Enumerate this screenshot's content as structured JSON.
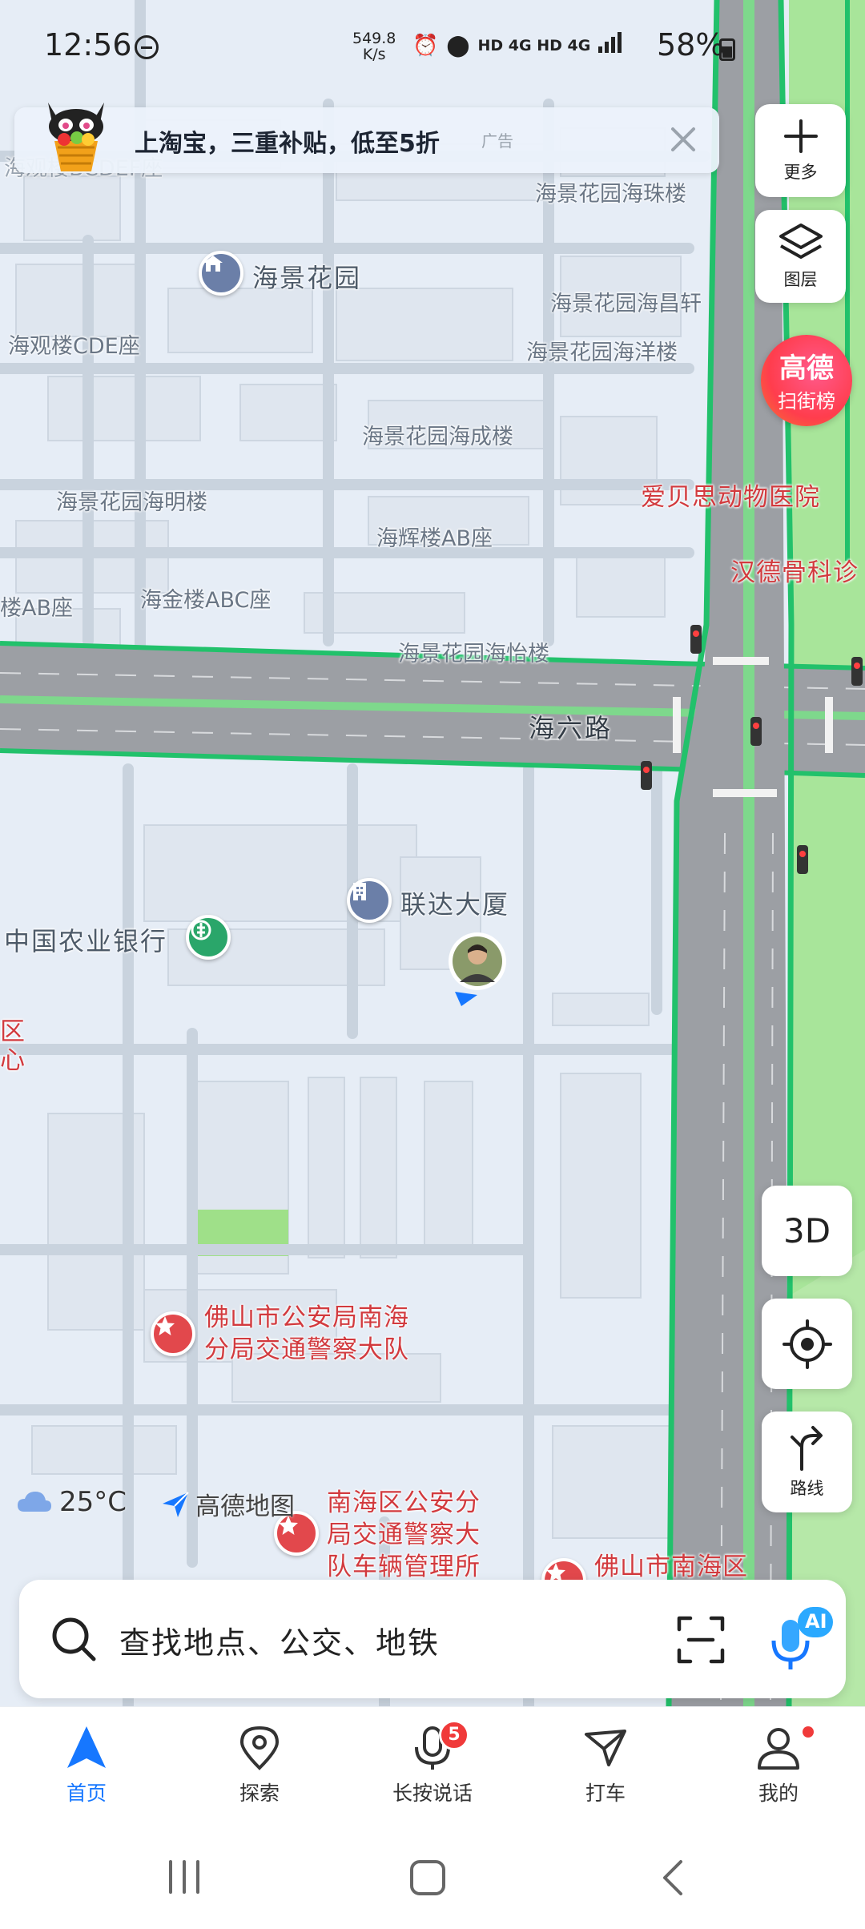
{
  "status_bar": {
    "time": "12:56",
    "net_speed_value": "549.8",
    "net_speed_unit": "K/s",
    "indicators": "HD 4G HD 4G",
    "battery": "58%"
  },
  "ad_banner": {
    "text": "上淘宝，三重补贴，低至5折",
    "tag": "广告"
  },
  "controls": {
    "more_label": "更多",
    "layers_label": "图层",
    "rank_line1": "高德",
    "rank_line2": "扫街榜",
    "view_3d_label": "3D",
    "route_label": "路线"
  },
  "map_labels": {
    "hai_jing_hua_yuan": "海景花园",
    "hai_zhu_lou": "海景花园海珠楼",
    "hai_chang_xuan": "海景花园海昌轩",
    "hai_yang_lou": "海景花园海洋楼",
    "hai_guan_lou": "海观楼CDE座",
    "hai_cheng_lou": "海景花园海成楼",
    "hai_ming_lou": "海景花园海明楼",
    "hai_hui_lou": "海辉楼AB座",
    "lou_ab": "楼AB座",
    "hai_jin_lou": "海金楼ABC座",
    "hai_yi_lou": "海景花园海怡楼",
    "top_left_cut": "海观楼BCDEF座",
    "road_name": "海六路",
    "lian_da": "联达大厦",
    "abc_bank": "中国农业银行",
    "pet_hospital": "爱贝思动物医院",
    "orthopedic": "汉德骨科诊",
    "police_line1": "佛山市公安局南海",
    "police_line2": "分局交通警察大队",
    "vehicle_line1": "南海区公安分",
    "vehicle_line2": "局交通警察大",
    "vehicle_line3": "队车辆管理所",
    "foshan_nanhai": "佛山市南海区",
    "left_edge_1": "区",
    "left_edge_2": "心"
  },
  "weather": {
    "temperature": "25°C"
  },
  "logo": {
    "text": "高德地图"
  },
  "search": {
    "placeholder": "查找地点、公交、地铁",
    "ai_badge": "AI"
  },
  "tabs": [
    {
      "label": "首页",
      "active": true
    },
    {
      "label": "探索",
      "active": false
    },
    {
      "label": "长按说话",
      "active": false,
      "badge": "5"
    },
    {
      "label": "打车",
      "active": false
    },
    {
      "label": "我的",
      "active": false,
      "dot": true
    }
  ],
  "colors": {
    "accent": "#1677ff",
    "route_green": "#22c16b",
    "poi_red": "#d23a3e"
  }
}
